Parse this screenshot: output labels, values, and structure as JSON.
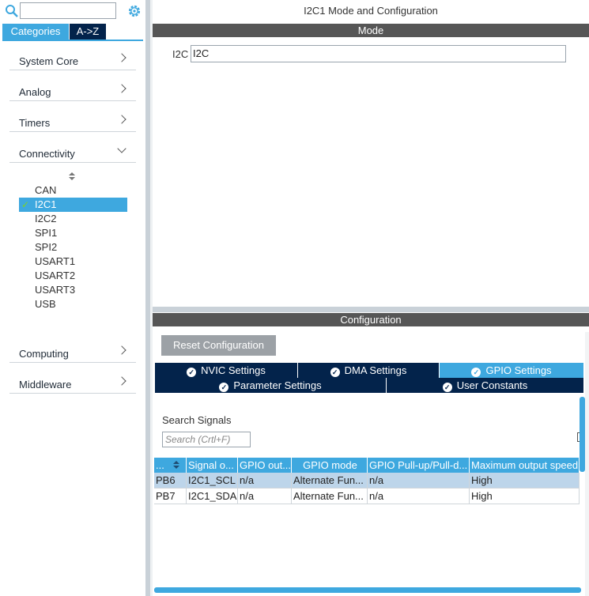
{
  "left": {
    "search": {
      "value": "",
      "placeholder": ""
    },
    "tabs": {
      "categories": "Categories",
      "az": "A->Z"
    },
    "categories": [
      {
        "label": "System Core",
        "expanded": false
      },
      {
        "label": "Analog",
        "expanded": false
      },
      {
        "label": "Timers",
        "expanded": false
      },
      {
        "label": "Connectivity",
        "expanded": true
      },
      {
        "label": "Computing",
        "expanded": false
      },
      {
        "label": "Middleware",
        "expanded": false
      }
    ],
    "connectivity_items": [
      "CAN",
      "I2C1",
      "I2C2",
      "SPI1",
      "SPI2",
      "USART1",
      "USART2",
      "USART3",
      "USB"
    ],
    "selected_item": "I2C1",
    "check_mark": "✓"
  },
  "mode_panel": {
    "title": "I2C1 Mode and Configuration",
    "mode_header": "Mode",
    "i2c_label": "I2C",
    "i2c_value": "I2C"
  },
  "config_panel": {
    "header": "Configuration",
    "reset_button": "Reset Configuration",
    "tabs": {
      "nvic": "NVIC Settings",
      "dma": "DMA Settings",
      "gpio": "GPIO Settings",
      "parameter": "Parameter Settings",
      "user_constants": "User Constants"
    },
    "active_tab": "GPIO Settings",
    "search_label": "Search Signals",
    "search_placeholder": "Search (Crtl+F)",
    "table": {
      "columns": [
        "...",
        "Signal o...",
        "GPIO out...",
        "GPIO mode",
        "GPIO Pull-up/Pull-d...",
        "Maximum output speed"
      ],
      "rows": [
        [
          "PB6",
          "I2C1_SCL",
          "n/a",
          "Alternate Fun...",
          "n/a",
          "High"
        ],
        [
          "PB7",
          "I2C1_SDA",
          "n/a",
          "Alternate Fun...",
          "n/a",
          "High"
        ]
      ]
    }
  },
  "colors": {
    "accent": "#3ea8df",
    "navy": "#03234b",
    "header_gray": "#565656",
    "button_gray": "#9ca1a6",
    "selected_row": "#bdd5ea"
  }
}
